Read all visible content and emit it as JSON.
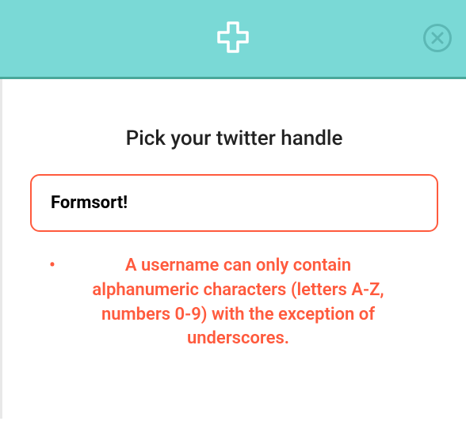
{
  "form": {
    "prompt": "Pick your twitter handle",
    "input_value": "Formsort!",
    "error_message": "A username can only contain alphanumeric characters (letters A-Z, numbers 0-9) with the exception of underscores."
  }
}
